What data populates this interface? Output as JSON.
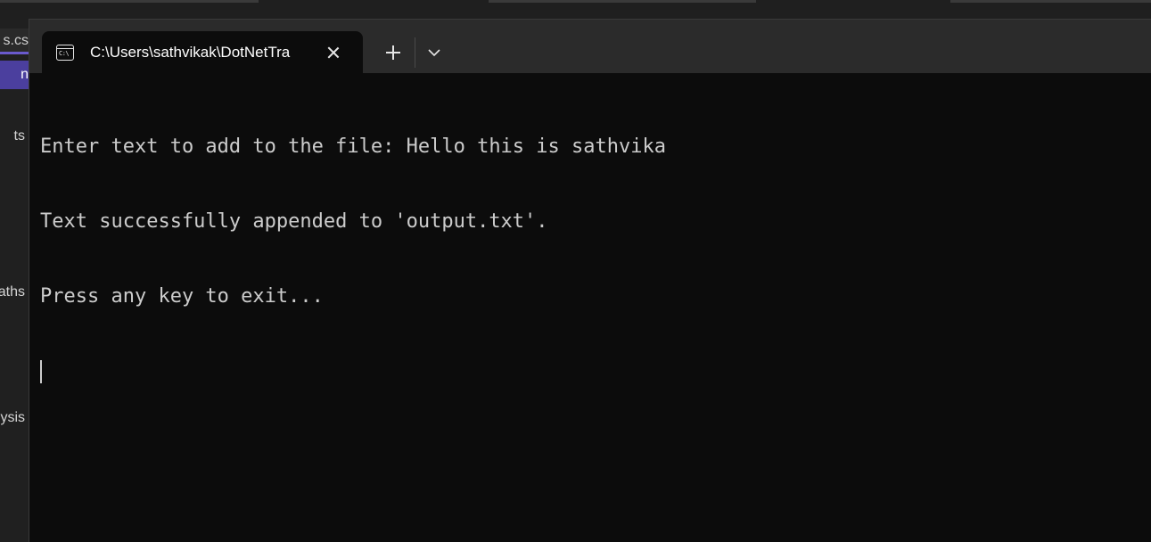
{
  "background_app": {
    "tab_fragment": "s.cs",
    "selected_item_fragment": "n",
    "side_fragments": [
      "ts",
      "Paths",
      "ysis"
    ]
  },
  "terminal": {
    "tab": {
      "icon": "console-icon",
      "icon_glyph": "C:\\",
      "title": "C:\\Users\\sathvikak\\DotNetTra"
    },
    "new_tab_icon": "plus-icon",
    "dropdown_icon": "chevron-down-icon",
    "output_lines": [
      "Enter text to add to the file: Hello this is sathvika",
      "Text successfully appended to 'output.txt'.",
      "Press any key to exit..."
    ]
  },
  "colors": {
    "terminal_bg": "#0c0c0c",
    "titlebar_bg": "#2b2b2b",
    "text": "#cccccc",
    "accent": "#4b3f9e"
  }
}
